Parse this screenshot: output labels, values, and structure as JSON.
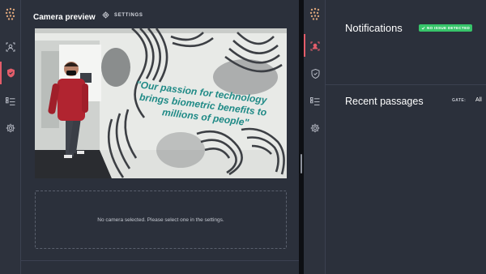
{
  "left_pane": {
    "title": "Camera preview",
    "settings_label": "SETTINGS",
    "rail_icons": [
      "logo-icon",
      "face-scan-icon",
      "shield-icon",
      "list-icon",
      "gear-icon"
    ],
    "camera": {
      "caption_line1": "\"Our passion for technology",
      "caption_line2": "brings biometric benefits to",
      "caption_line3": "millions of people\""
    },
    "empty_message": "No camera selected. Please select one in the settings."
  },
  "right_pane": {
    "rail_icons": [
      "logo-icon",
      "face-scan-icon",
      "shield-icon",
      "list-icon",
      "gear-icon"
    ],
    "notifications_title": "Notifications",
    "status_badge": "NO ISSUE DETECTED",
    "passages_title": "Recent passages",
    "gate_label": "GATE:",
    "gate_value": "All"
  },
  "colors": {
    "background": "#2b303b",
    "accent_active": "#e35d6a",
    "status_ok": "#37c56a"
  }
}
